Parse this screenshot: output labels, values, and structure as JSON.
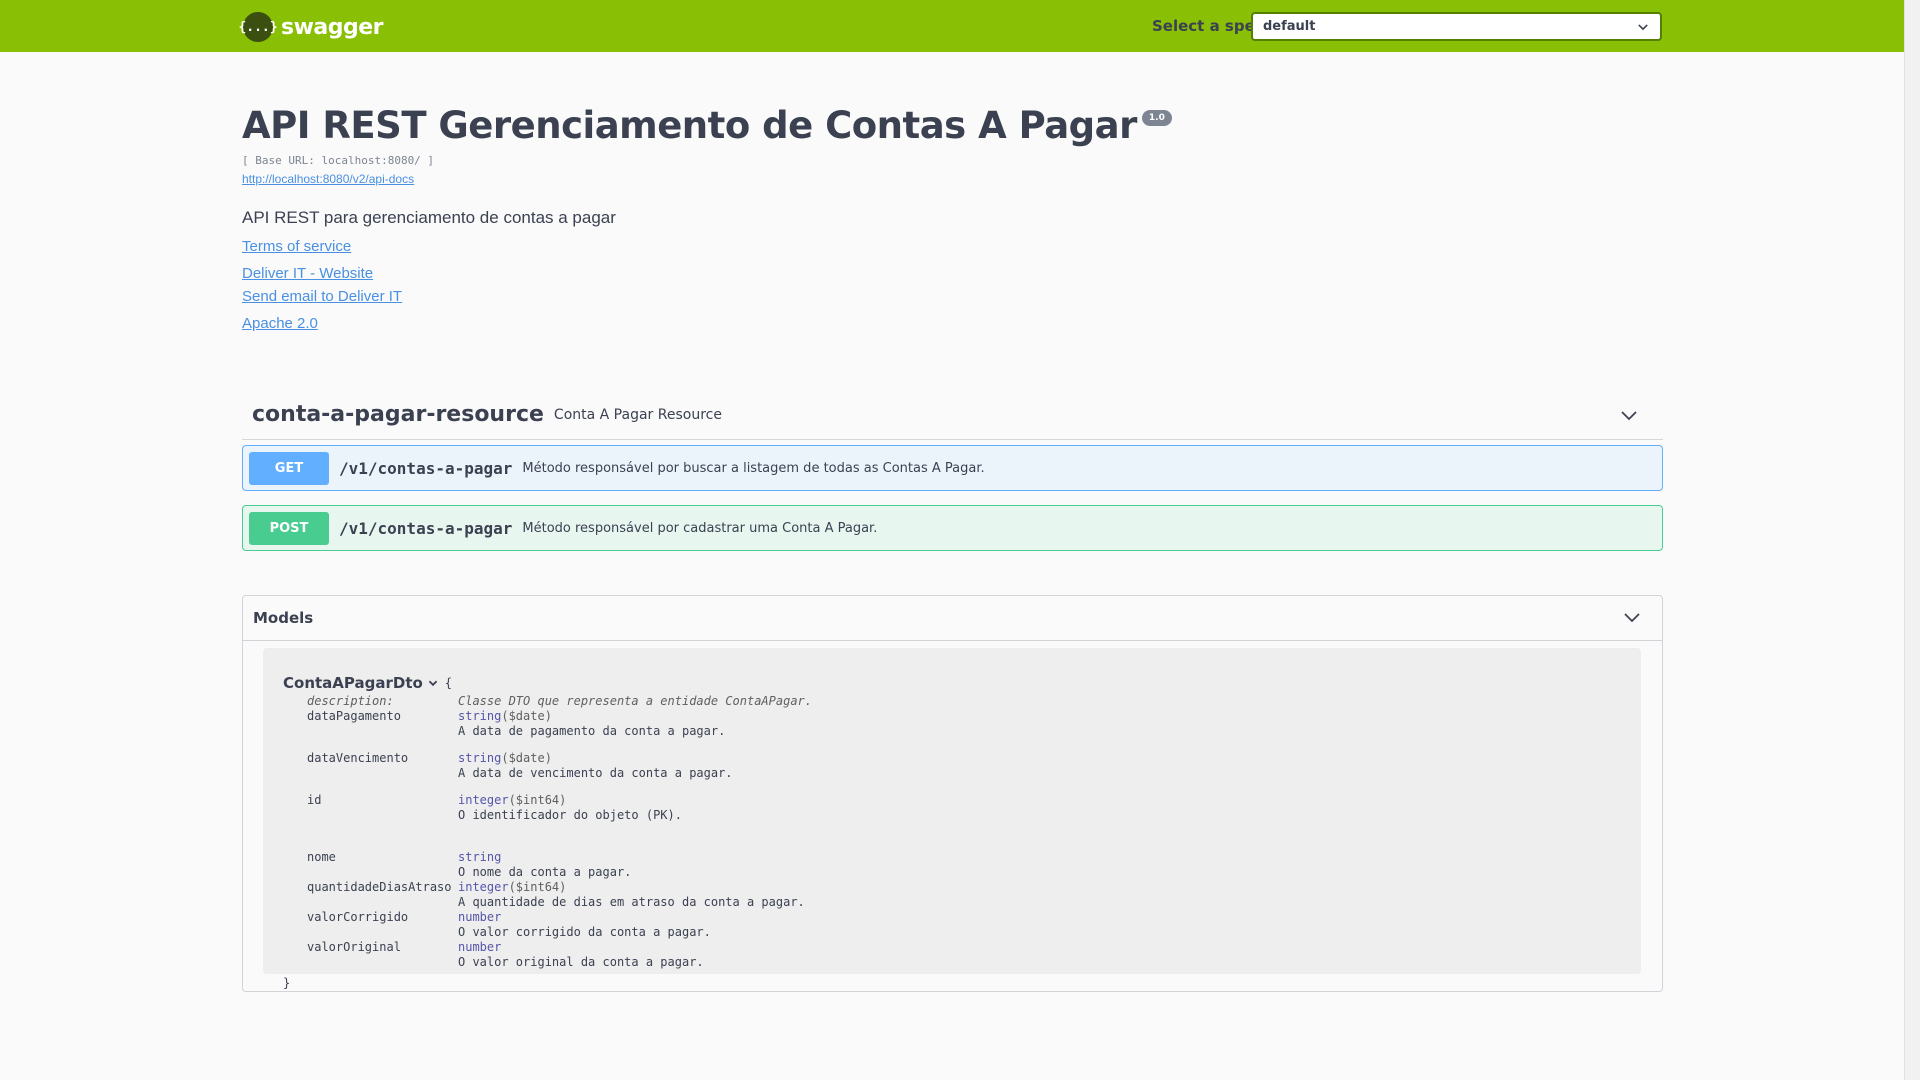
{
  "topbar": {
    "logo_symbol": "{...}",
    "logo_text": "swagger",
    "spec_label": "Select a spec",
    "spec_value": "default",
    "bg_color": "#89bf04"
  },
  "info": {
    "title": "API REST Gerenciamento de Contas A Pagar",
    "version": "1.0",
    "base_url": "[ Base URL: localhost:8080/ ]",
    "api_docs_link": "http://localhost:8080/v2/api-docs",
    "description": "API REST para gerenciamento de contas a pagar",
    "terms": "Terms of service",
    "website": "Deliver IT - Website",
    "email": "Send email to Deliver IT",
    "license": "Apache 2.0"
  },
  "tag": {
    "name": "conta-a-pagar-resource",
    "description": "Conta A Pagar Resource"
  },
  "operations": [
    {
      "method": "GET",
      "path": "/v1/contas-a-pagar",
      "summary": "Método responsável por buscar a listagem de todas as Contas A Pagar.",
      "color": "#61affe"
    },
    {
      "method": "POST",
      "path": "/v1/contas-a-pagar",
      "summary": "Método responsável por cadastrar uma Conta A Pagar.",
      "color": "#49cc90"
    }
  ],
  "models": {
    "title": "Models",
    "model_name": "ContaAPagarDto",
    "open_brace": "{",
    "close_brace": "}",
    "description_key": "description:",
    "description_value": "Classe DTO que representa a entidade ContaAPagar.",
    "properties": [
      {
        "name": "dataPagamento",
        "type": "string",
        "format": "($date)",
        "desc": "A data de pagamento da conta a pagar."
      },
      {
        "name": "dataVencimento",
        "type": "string",
        "format": "($date)",
        "desc": "A data de vencimento da conta a pagar."
      },
      {
        "name": "id",
        "type": "integer",
        "format": "($int64)",
        "desc": "O identificador do objeto (PK)."
      },
      {
        "name": "nome",
        "type": "string",
        "format": "",
        "desc": "O nome da conta a pagar."
      },
      {
        "name": "quantidadeDiasAtraso",
        "type": "integer",
        "format": "($int64)",
        "desc": "A quantidade de dias em atraso da conta a pagar."
      },
      {
        "name": "valorCorrigido",
        "type": "number",
        "format": "",
        "desc": "O valor corrigido da conta a pagar."
      },
      {
        "name": "valorOriginal",
        "type": "number",
        "format": "",
        "desc": "O valor original da conta a pagar."
      }
    ]
  }
}
